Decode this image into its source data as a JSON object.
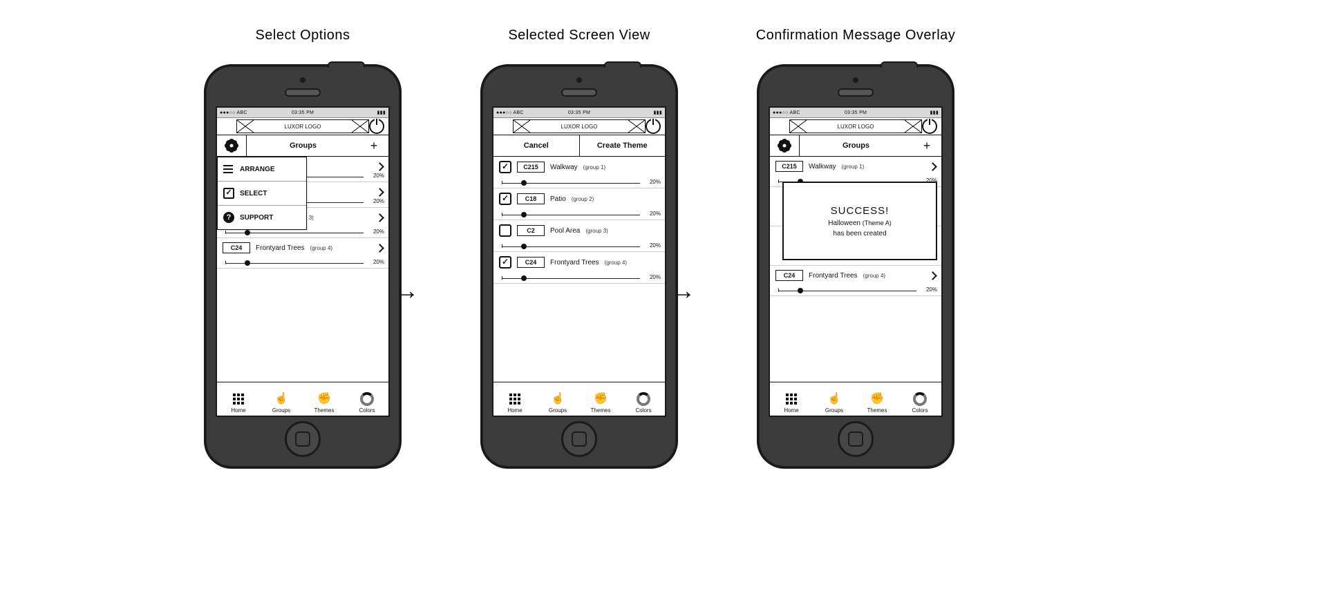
{
  "titles": {
    "screen1": "Select Options",
    "screen2": "Selected Screen View",
    "screen3": "Confirmation Message Overlay"
  },
  "status_bar": {
    "left": "●●●○○ ABC",
    "center": "03:35 PM",
    "right": "▮▮▮"
  },
  "logo_text": "LUXOR LOGO",
  "header": {
    "groups_title": "Groups",
    "cancel": "Cancel",
    "create_theme": "Create Theme"
  },
  "menu": {
    "arrange": "ARRANGE",
    "select": "SELECT",
    "support": "SUPPORT"
  },
  "rows": [
    {
      "tag": "C215",
      "name": "Walkway",
      "group": "(group 1)",
      "pct": "20%",
      "slider": 0.14,
      "checked": true
    },
    {
      "tag": "C18",
      "name": "Patio",
      "group": "(group 2)",
      "pct": "20%",
      "slider": 0.14,
      "checked": true
    },
    {
      "tag": "C2",
      "name": "Pool Area",
      "group": "(group 3)",
      "pct": "20%",
      "slider": 0.14,
      "checked": false
    },
    {
      "tag": "C24",
      "name": "Frontyard Trees",
      "group": "(group 4)",
      "pct": "20%",
      "slider": 0.14,
      "checked": true
    }
  ],
  "tabs": {
    "home": "Home",
    "groups": "Groups",
    "themes": "Themes",
    "colors": "Colors"
  },
  "overlay": {
    "success": "SUCCESS!",
    "name": "Halloween",
    "theme": "(Theme A)",
    "line2": "has been created"
  }
}
